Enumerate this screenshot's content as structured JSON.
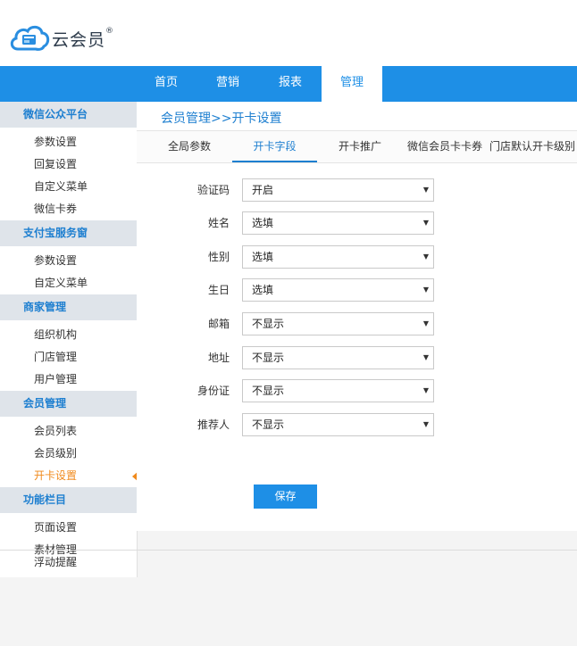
{
  "brand": {
    "name": "云会员",
    "reg": "®"
  },
  "nav": {
    "items": [
      {
        "label": "首页",
        "active": false
      },
      {
        "label": "营销",
        "active": false
      },
      {
        "label": "报表",
        "active": false
      },
      {
        "label": "管理",
        "active": true
      }
    ]
  },
  "sidebar": {
    "groups": [
      {
        "title": "微信公众平台",
        "items": [
          "参数设置",
          "回复设置",
          "自定义菜单",
          "微信卡券"
        ]
      },
      {
        "title": "支付宝服务窗",
        "items": [
          "参数设置",
          "自定义菜单"
        ]
      },
      {
        "title": "商家管理",
        "items": [
          "组织机构",
          "门店管理",
          "用户管理"
        ]
      },
      {
        "title": "会员管理",
        "items": [
          "会员列表",
          "会员级别",
          "开卡设置"
        ]
      },
      {
        "title": "功能栏目",
        "items": [
          "页面设置",
          "素材管理"
        ]
      }
    ],
    "active_item": "开卡设置",
    "overflow_item": "浮动提醒"
  },
  "main": {
    "breadcrumb": "会员管理>>开卡设置",
    "tabs": [
      {
        "label": "全局参数",
        "active": false
      },
      {
        "label": "开卡字段",
        "active": true
      },
      {
        "label": "开卡推广",
        "active": false
      },
      {
        "label": "微信会员卡卡券",
        "active": false
      },
      {
        "label": "门店默认开卡级别",
        "active": false
      }
    ],
    "fields": [
      {
        "label": "验证码",
        "value": "开启"
      },
      {
        "label": "姓名",
        "value": "选填"
      },
      {
        "label": "性别",
        "value": "选填"
      },
      {
        "label": "生日",
        "value": "选填"
      },
      {
        "label": "邮箱",
        "value": "不显示"
      },
      {
        "label": "地址",
        "value": "不显示"
      },
      {
        "label": "身份证",
        "value": "不显示"
      },
      {
        "label": "推荐人",
        "value": "不显示"
      }
    ],
    "save_label": "保存"
  },
  "colors": {
    "accent": "#1e8fe6",
    "active_item": "#f08a1c",
    "group_bg": "#dfe4ea"
  },
  "icons": {
    "logo": "cloud-card-logo-icon",
    "dropdown": "dropdown-caret-icon",
    "active_marker": "left-triangle-icon"
  }
}
